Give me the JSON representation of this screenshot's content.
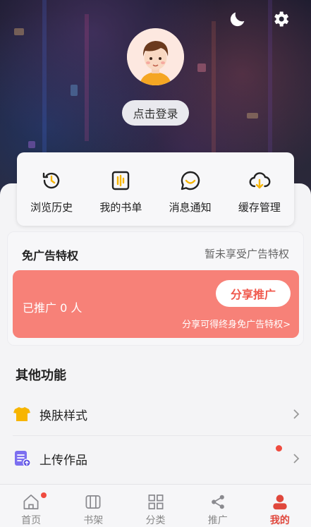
{
  "header": {
    "moon_icon": "moon-icon",
    "gear_icon": "gear-icon",
    "login_label": "点击登录"
  },
  "quick_actions": [
    {
      "label": "浏览历史",
      "icon": "history-icon"
    },
    {
      "label": "我的书单",
      "icon": "booklist-icon"
    },
    {
      "label": "消息通知",
      "icon": "message-icon"
    },
    {
      "label": "缓存管理",
      "icon": "cloud-download-icon"
    }
  ],
  "promo": {
    "title": "免广告特权",
    "status": "暂未享受广告特权",
    "promoted_text": "已推广 0 人",
    "share_label": "分享推广",
    "share_hint": "分享可得终身免广告特权>",
    "banner_color": "#f78178"
  },
  "other": {
    "title": "其他功能",
    "items": [
      {
        "label": "换肤样式",
        "icon": "tshirt-icon"
      },
      {
        "label": "上传作品",
        "icon": "upload-doc-icon"
      }
    ]
  },
  "tabs": [
    {
      "label": "首页",
      "icon": "home-icon"
    },
    {
      "label": "书架",
      "icon": "bookshelf-icon"
    },
    {
      "label": "分类",
      "icon": "category-icon"
    },
    {
      "label": "推广",
      "icon": "share-icon"
    },
    {
      "label": "我的",
      "icon": "user-icon",
      "active": true
    }
  ],
  "colors": {
    "accent": "#e0473c",
    "badge": "#ef4b3f",
    "icon_yellow": "#f7b500"
  }
}
